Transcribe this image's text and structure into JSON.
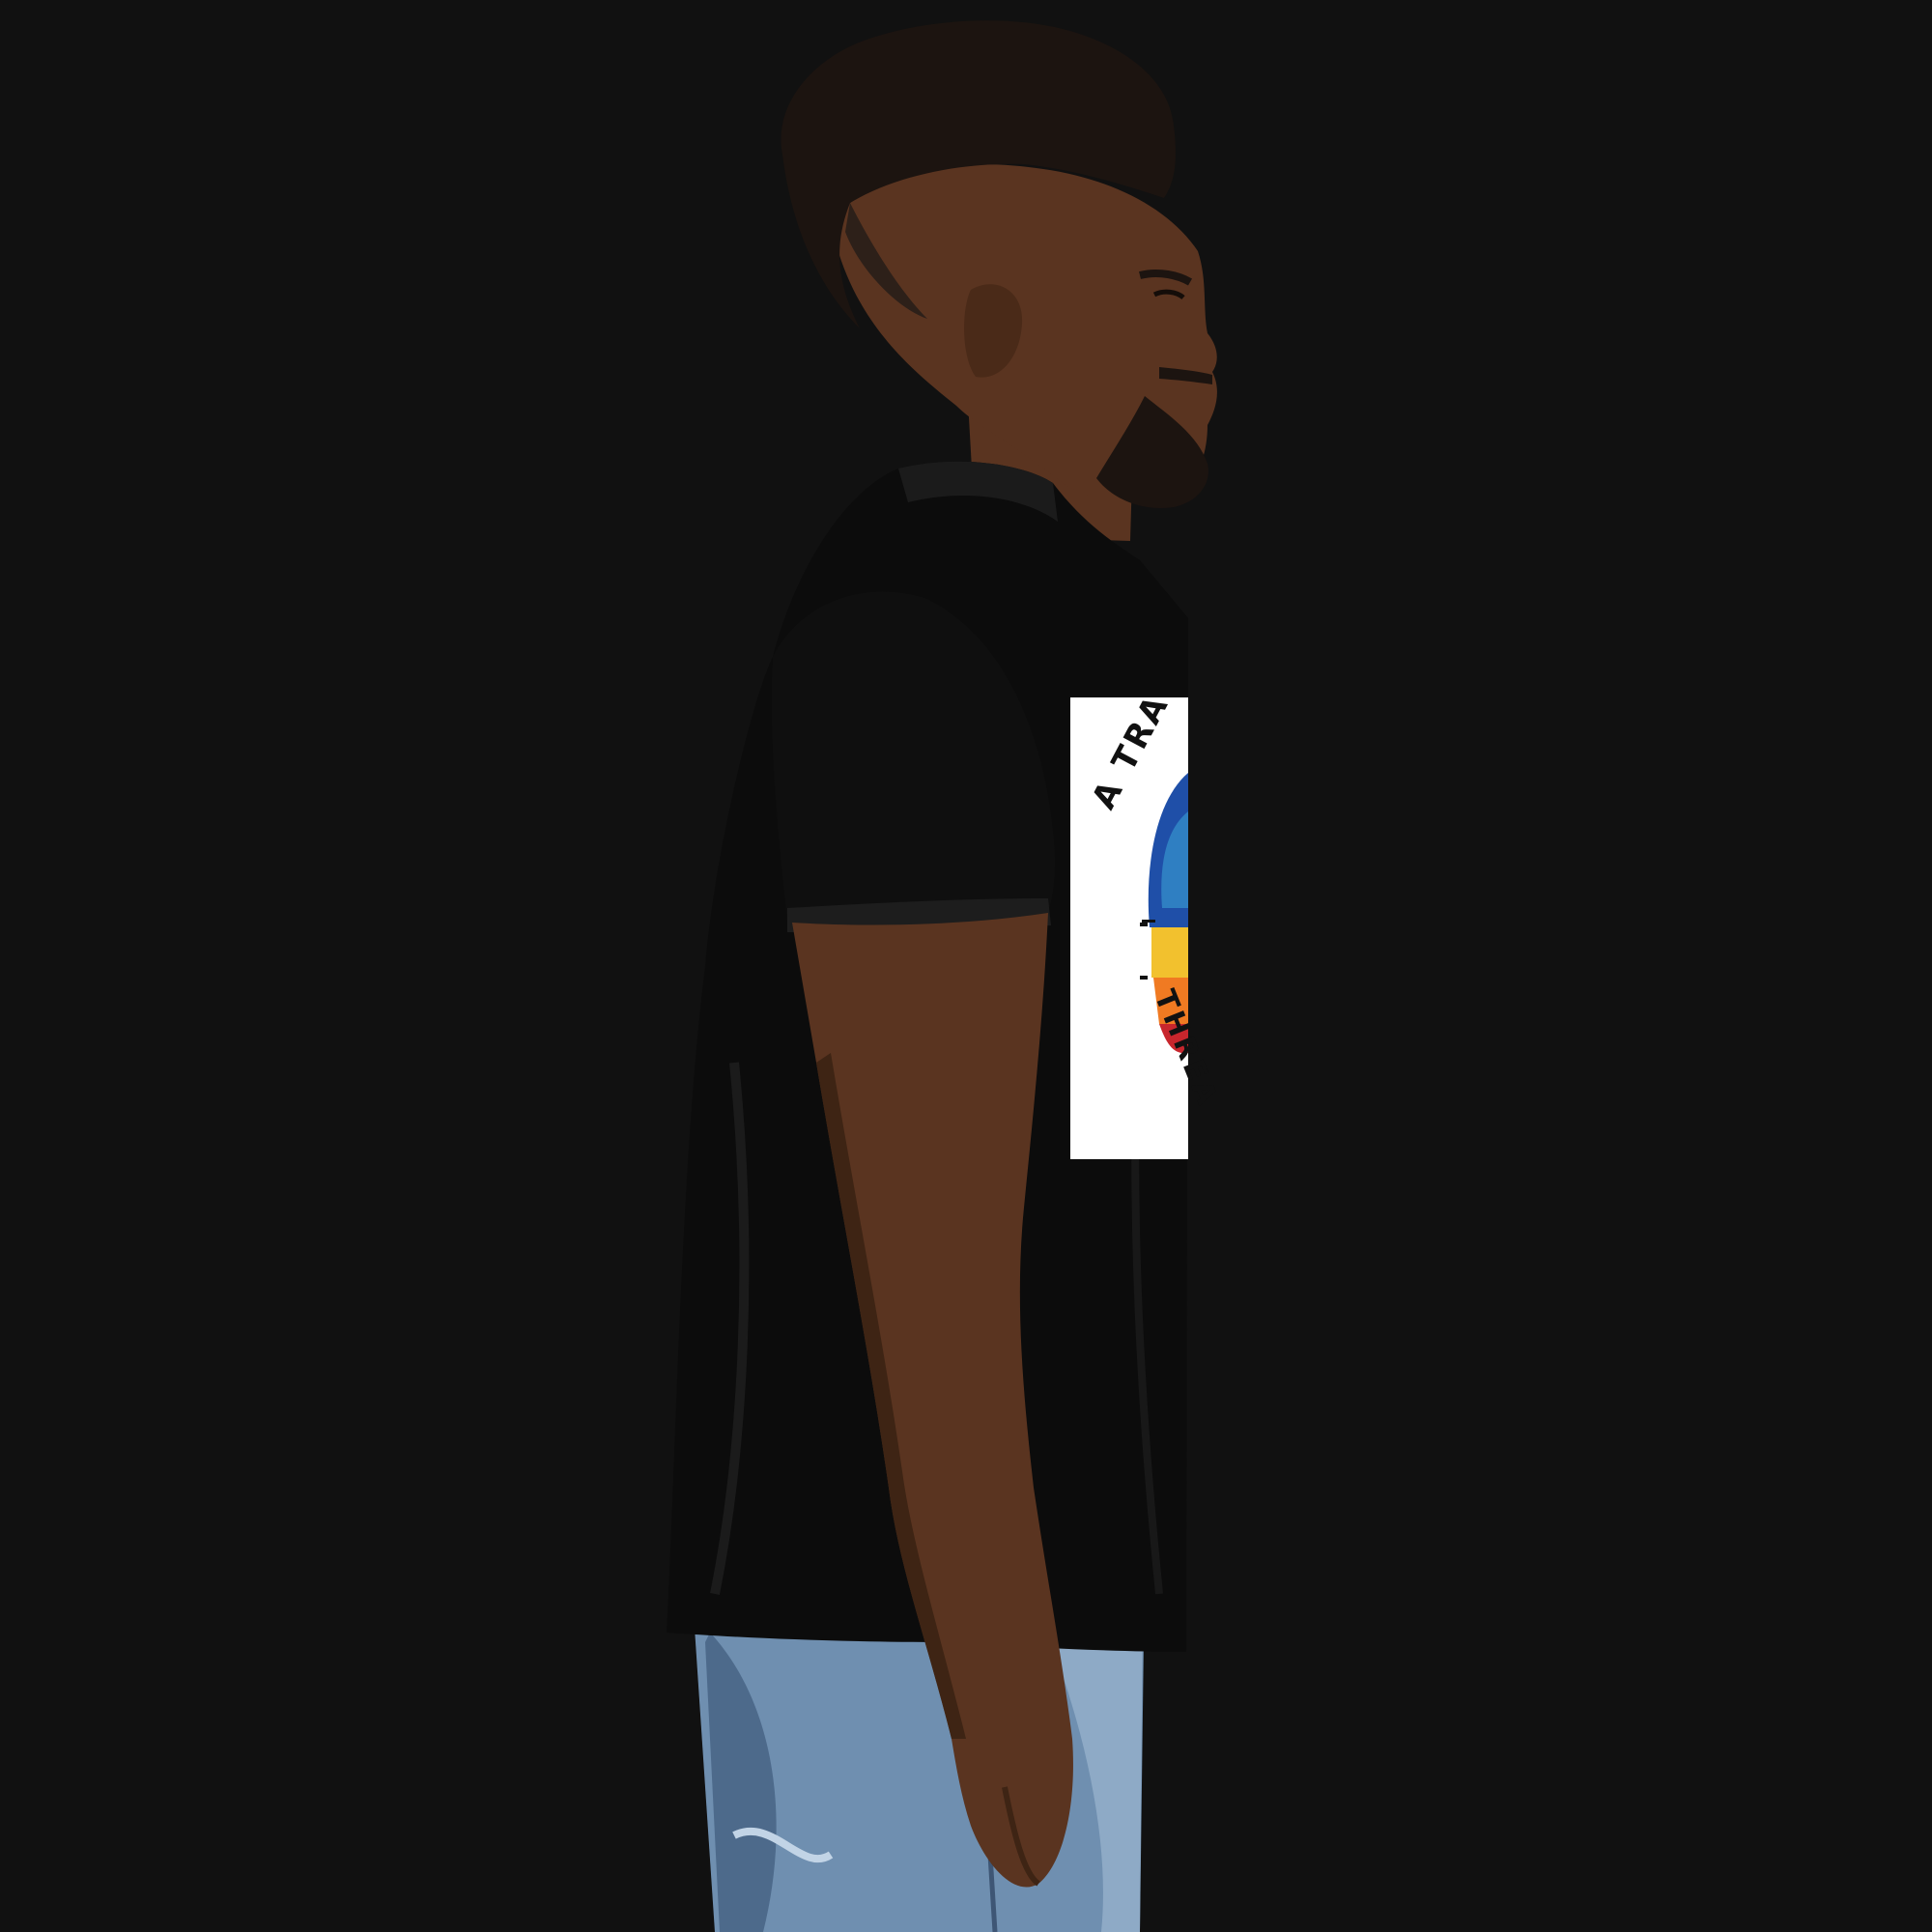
{
  "scene": {
    "background": "#111111",
    "subject": "person-profile-in-tshirt"
  },
  "shirt_print": {
    "line_top": "A TRA",
    "line_bottom": "THREA",
    "colors": {
      "panel": "#ffffff",
      "blue": "#1f4fa8",
      "yellow": "#f2c12e",
      "orange": "#f07a22",
      "red": "#c8262d",
      "black": "#111111"
    }
  },
  "colors": {
    "skin": "#5a3420",
    "skin_shadow": "#3e2414",
    "hair": "#1c1410",
    "shirt": "#0c0c0c",
    "shirt_fold": "#1b1b1b",
    "denim": "#6f8fb0",
    "denim_dark": "#4d6a8b"
  }
}
